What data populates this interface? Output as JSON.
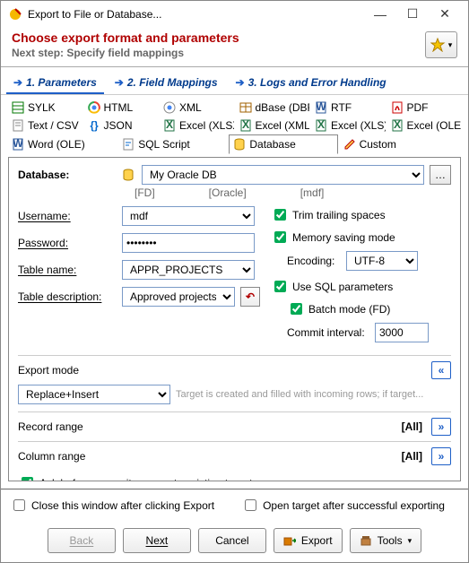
{
  "window": {
    "title": "Export to File or Database..."
  },
  "header": {
    "title": "Choose export format and parameters",
    "subtitle": "Next step: Specify field mappings"
  },
  "steps": {
    "s1": "1. Parameters",
    "s2": "2. Field Mappings",
    "s3": "3. Logs and Error Handling"
  },
  "formats": {
    "sylk": "SYLK",
    "html": "HTML",
    "xml": "XML",
    "dbase": "dBase (DBF)",
    "rtf": "RTF",
    "pdf": "PDF",
    "csv": "Text / CSV",
    "json": "JSON",
    "xlsx": "Excel (XLSX)",
    "excelxml": "Excel (XML)",
    "xls": "Excel (XLS)",
    "ole": "Excel (OLE)",
    "wordole": "Word (OLE)",
    "sqlscript": "SQL Script",
    "database": "Database",
    "custom": "Custom"
  },
  "db": {
    "label": "Database:",
    "value": "My Oracle DB",
    "tags": {
      "fd": "[FD]",
      "oracle": "[Oracle]",
      "mdf": "[mdf]"
    },
    "username_label": "Username:",
    "username": "mdf",
    "password_label": "Password:",
    "password": "••••••••",
    "table_label": "Table name:",
    "table": "APPR_PROJECTS",
    "desc_label": "Table description:",
    "desc": "Approved projects"
  },
  "opts": {
    "trim": "Trim trailing spaces",
    "memsave": "Memory saving mode",
    "encoding_label": "Encoding:",
    "encoding": "UTF-8",
    "usesql": "Use SQL parameters",
    "batch": "Batch mode (FD)",
    "commit_label": "Commit interval:",
    "commit": "3000"
  },
  "export_mode": {
    "label": "Export mode",
    "value": "Replace+Insert",
    "hint": "Target is created and filled with incoming rows; if target..."
  },
  "record_range": {
    "label": "Record range",
    "value": "[All]"
  },
  "column_range": {
    "label": "Column range",
    "value": "[All]"
  },
  "ask_overwrite": "Ask before overwrite or empty existing target",
  "footer": {
    "close_after": "Close this window after clicking Export",
    "open_after": "Open target after successful exporting",
    "back": "Back",
    "next": "Next",
    "cancel": "Cancel",
    "export": "Export",
    "tools": "Tools"
  }
}
